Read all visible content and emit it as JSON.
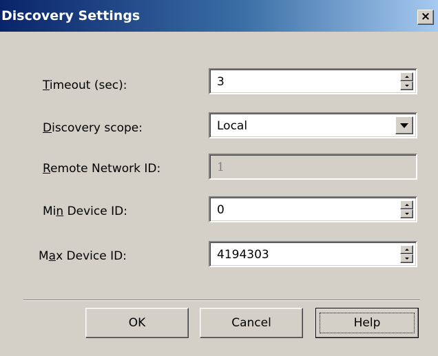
{
  "window": {
    "title": "Discovery Settings",
    "close_label": "×"
  },
  "fields": {
    "timeout": {
      "label_prefix": "",
      "label_key": "T",
      "label_rest": "imeout (sec):",
      "value": "3"
    },
    "scope": {
      "label_prefix": "",
      "label_key": "D",
      "label_rest": "iscovery scope:",
      "value": "Local"
    },
    "remote": {
      "label_prefix": "",
      "label_key": "R",
      "label_rest": "emote Network ID:",
      "value": "1"
    },
    "min_id": {
      "label_prefix": "Mi",
      "label_key": "n",
      "label_rest": " Device ID:",
      "value": "0"
    },
    "max_id": {
      "label_prefix": "M",
      "label_key": "a",
      "label_rest": "x Device ID:",
      "value": "4194303"
    }
  },
  "buttons": {
    "ok": "OK",
    "cancel": "Cancel",
    "help": "Help"
  },
  "icons": {
    "close": "close-icon",
    "spin_up": "spin-up-icon",
    "spin_down": "spin-down-icon",
    "dropdown": "chevron-down-icon"
  }
}
